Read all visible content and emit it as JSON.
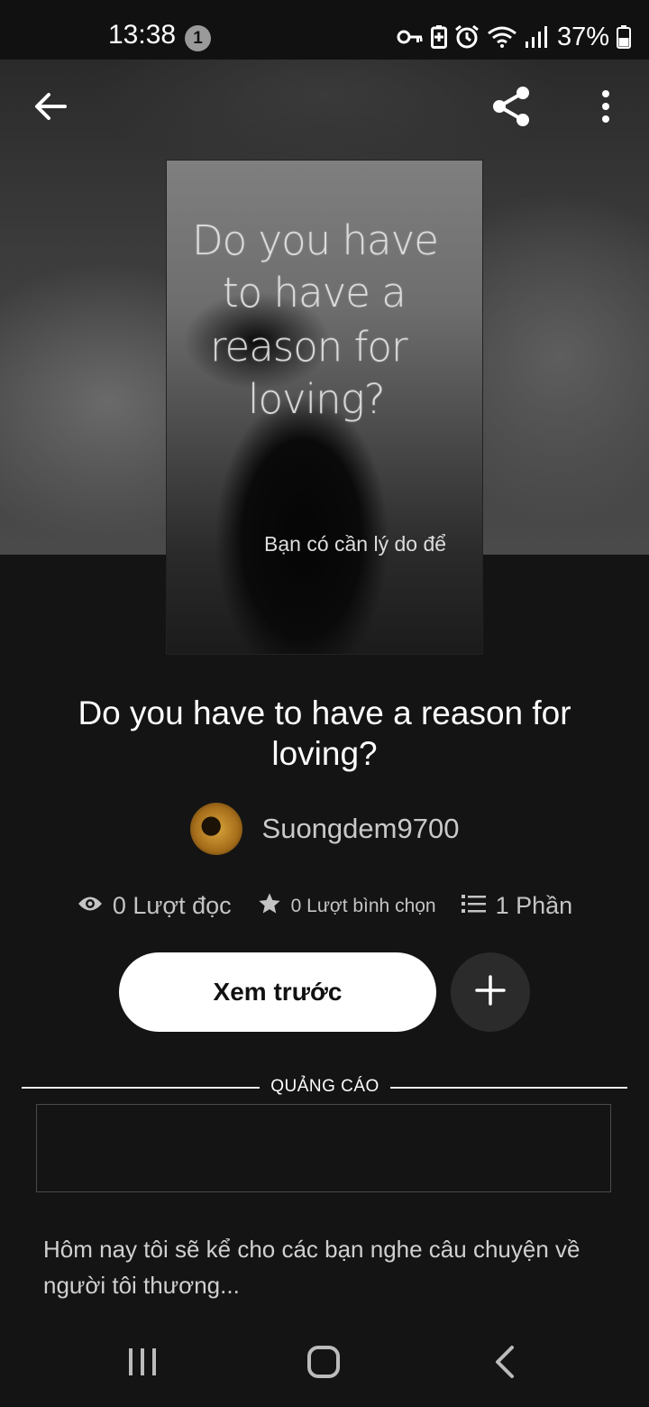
{
  "status_bar": {
    "time": "13:38",
    "notification_count": "1",
    "battery_percent": "37%",
    "icons": [
      "key-icon",
      "battery-saver-icon",
      "alarm-icon",
      "wifi-icon",
      "signal-icon",
      "battery-icon"
    ]
  },
  "toolbar": {
    "back_icon": "arrow-left-icon",
    "share_icon": "share-icon",
    "more_icon": "more-vertical-icon"
  },
  "cover": {
    "lines": [
      "Do you have",
      "to have a",
      "reason for",
      "loving?"
    ],
    "subtitle": "Bạn có cần lý do để"
  },
  "story": {
    "title": "Do you have to have a reason for loving?",
    "author": "Suongdem9700",
    "reads": "0 Lượt đọc",
    "votes": "0 Lượt bình chọn",
    "parts": "1 Phần",
    "description": "Hôm nay tôi sẽ kể cho các bạn nghe câu chuyện về người tôi thương..."
  },
  "actions": {
    "preview_label": "Xem trước",
    "add_icon": "plus-icon"
  },
  "ad": {
    "label": "QUẢNG CÁO"
  },
  "colors": {
    "background": "#141414",
    "primary_button": "#ffffff",
    "secondary_button": "#2b2b2b",
    "muted_text": "#c4c4c4"
  }
}
